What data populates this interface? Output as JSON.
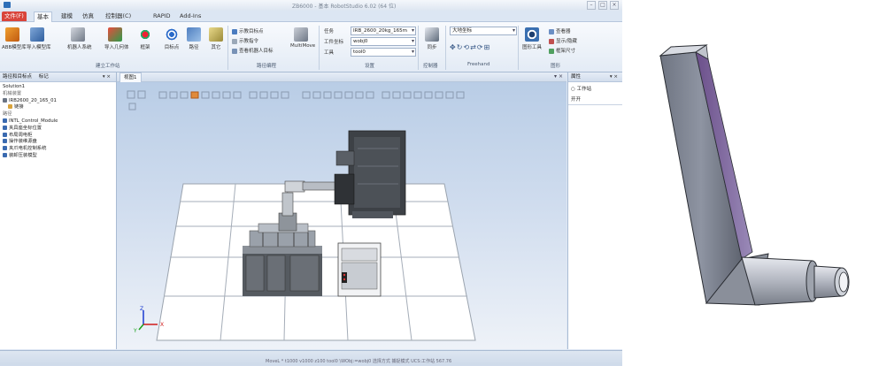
{
  "titlebar": {
    "title": "ZB6000 - 基本 RobotStudio 6.02 (64 位)"
  },
  "tabs": [
    "文件(F)",
    "基本",
    "建模",
    "仿真",
    "控制器(C)",
    "RAPID",
    "Add-Ins"
  ],
  "ribbon": {
    "build_station": {
      "buttons": [
        "ABB模型库",
        "导入模型库",
        "机器人系统",
        "导入几何体",
        "框架",
        "目标点",
        "路径",
        "其它"
      ],
      "label": "建立工作站"
    },
    "path_programming": {
      "items": [
        "示教目标点",
        "示教指令",
        "查看机器人目标"
      ],
      "button": "MultiMove",
      "label": "路径编程"
    },
    "settings": {
      "task_label": "任务",
      "task_value": "IRB_2600_20kg_165m",
      "wobj_label": "工件坐标",
      "wobj_value": "wobj0",
      "tool_label": "工具",
      "tool_value": "tool0",
      "label": "设置"
    },
    "controller": {
      "button": "同步",
      "label": "控制器"
    },
    "freehand": {
      "combo": "大地坐标",
      "label": "Freehand"
    },
    "graphics": {
      "button": "图形工具",
      "items": [
        "查看器",
        "显示/隐藏",
        "框架尺寸"
      ],
      "label": "图形"
    }
  },
  "left_panel": {
    "tabs": [
      "路径和目标点",
      "标记"
    ],
    "tree": [
      "Solution1",
      "机械装置",
      "IRB2600_20_165_01",
      "链接",
      "路径",
      "INTL_Control_Module",
      "夹具座坐标位置",
      "布局周电柜",
      "操作装维源盘",
      "夹爪电机控制系统",
      "装卸压装模型"
    ]
  },
  "view": {
    "tab": "视图1"
  },
  "right_panel": {
    "tab": "属性",
    "radio": "工作站",
    "item": "开开"
  },
  "statusbar": {
    "text": "MoveL * t1000 v1000 z100 tool0 \\WObj:=wobj0   选择方式  捕捉模式  UCS:工作站  567.76"
  },
  "axis": {
    "x": "X",
    "y": "Y",
    "z": "Z"
  }
}
